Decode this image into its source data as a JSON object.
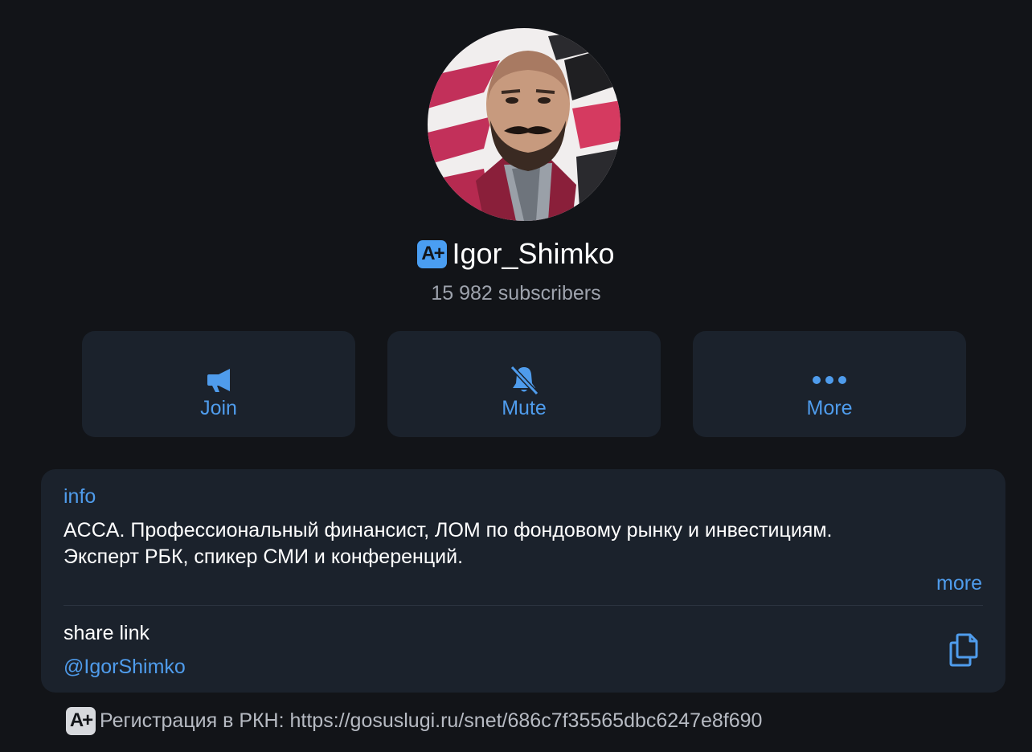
{
  "channel": {
    "name": "Igor_Shimko",
    "badge_text": "A+",
    "subscribers": "15 982 subscribers"
  },
  "actions": [
    {
      "label": "Join",
      "icon": "megaphone-icon"
    },
    {
      "label": "Mute",
      "icon": "bell-slash-icon"
    },
    {
      "label": "More",
      "icon": "ellipsis-icon"
    }
  ],
  "info": {
    "label": "info",
    "line1": "ACCA. Профессиональный финансист, ЛОМ по фондовому рынку и инвестициям.",
    "line2": "Эксперт РБК, спикер СМИ и конференций.",
    "more_label": "more"
  },
  "share": {
    "label": "share link",
    "value": "@IgorShimko",
    "icon": "copy-icon"
  },
  "footer": {
    "badge_text": "A+",
    "text": "Регистрация в РКН: https://gosuslugi.ru/snet/686c7f35565dbc6247e8f690"
  },
  "colors": {
    "background": "#121418",
    "card": "#1b222c",
    "accent": "#4f9cec",
    "badge": "#4a9ef2",
    "muted_text": "#9ea3ad"
  }
}
